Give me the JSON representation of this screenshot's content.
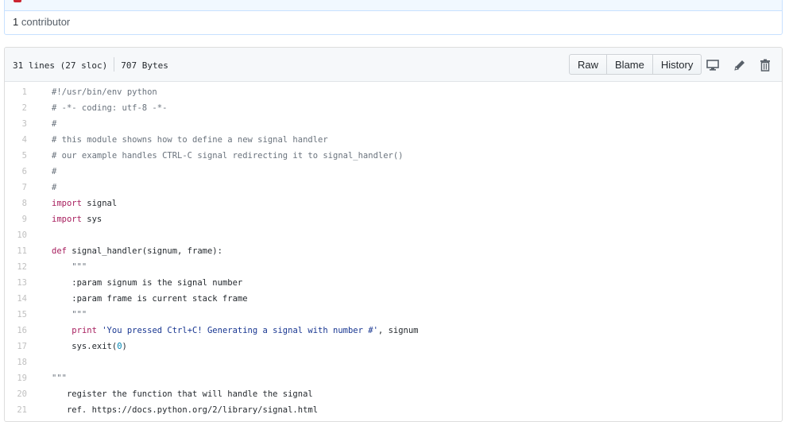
{
  "contributors": {
    "count": "1",
    "label": " contributor"
  },
  "file_header": {
    "lines_info": "31 lines (27 sloc)",
    "size_info": "707 Bytes",
    "buttons": {
      "raw": "Raw",
      "blame": "Blame",
      "history": "History"
    }
  },
  "icons": [
    "desktop-icon",
    "pencil-icon",
    "trash-icon"
  ],
  "code": {
    "line_numbers": [
      "1",
      "2",
      "3",
      "4",
      "5",
      "6",
      "7",
      "8",
      "9",
      "10",
      "11",
      "12",
      "13",
      "14",
      "15",
      "16",
      "17",
      "18",
      "19",
      "20",
      "21"
    ],
    "lines": [
      [
        {
          "t": "#!/usr/bin/env python",
          "c": "comment"
        }
      ],
      [
        {
          "t": "# -*- coding: utf-8 -*-",
          "c": "comment"
        }
      ],
      [
        {
          "t": "#",
          "c": "comment"
        }
      ],
      [
        {
          "t": "# this module showns how to define a new signal handler",
          "c": "comment"
        }
      ],
      [
        {
          "t": "# our example handles CTRL-C signal redirecting it to signal_handler()",
          "c": "comment"
        }
      ],
      [
        {
          "t": "#",
          "c": "comment"
        }
      ],
      [
        {
          "t": "#",
          "c": "comment"
        }
      ],
      [
        {
          "t": "import",
          "c": "kw"
        },
        {
          "t": " signal",
          "c": ""
        }
      ],
      [
        {
          "t": "import",
          "c": "kw"
        },
        {
          "t": " sys",
          "c": ""
        }
      ],
      [],
      [
        {
          "t": "def",
          "c": "kw"
        },
        {
          "t": " signal_handler(signum, frame):",
          "c": ""
        }
      ],
      [
        {
          "t": "    \"\"\"",
          "c": "comment"
        }
      ],
      [
        {
          "t": "    :param signum is the signal number",
          "c": ""
        }
      ],
      [
        {
          "t": "    :param frame is current stack frame",
          "c": ""
        }
      ],
      [
        {
          "t": "    \"\"\"",
          "c": "comment"
        }
      ],
      [
        {
          "t": "    ",
          "c": ""
        },
        {
          "t": "print",
          "c": "kw"
        },
        {
          "t": " ",
          "c": ""
        },
        {
          "t": "'You pressed Ctrl+C! Generating a signal with number #'",
          "c": "str"
        },
        {
          "t": ", signum",
          "c": ""
        }
      ],
      [
        {
          "t": "    sys.exit(",
          "c": ""
        },
        {
          "t": "0",
          "c": "num"
        },
        {
          "t": ")",
          "c": ""
        }
      ],
      [],
      [
        {
          "t": "\"\"\"",
          "c": "comment"
        }
      ],
      [
        {
          "t": "   register the function that will handle the signal",
          "c": ""
        }
      ],
      [
        {
          "t": "   ref. https://docs.python.org/2/library/signal.html",
          "c": ""
        }
      ]
    ]
  }
}
